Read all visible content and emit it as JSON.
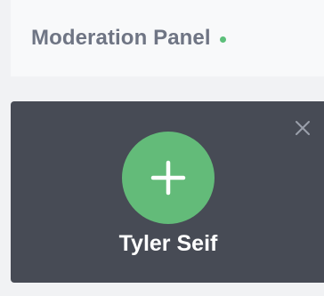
{
  "header": {
    "title": "Moderation Panel",
    "status_color": "#5cbf7a"
  },
  "card": {
    "user_name": "Tyler Seif",
    "add_icon": "plus-icon",
    "close_icon": "close-icon",
    "accent_color": "#63bb79"
  }
}
